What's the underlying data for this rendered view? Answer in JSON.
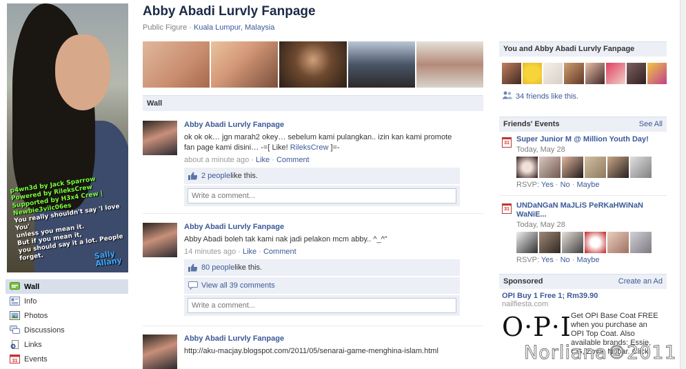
{
  "page": {
    "title": "Abby Abadi Lurvly Fanpage",
    "category": "Public Figure",
    "location": "Kuala Lumpur, Malaysia"
  },
  "profile_caption": {
    "line1": "p4wn3d by Jack Sparrow",
    "line2": "Powered by RileksCrew",
    "line3": "Supported by H3x4 Crew | Newbie3vilc06es",
    "line4": "You really shouldn't say 'I love You'",
    "line5": "unless you mean it.",
    "line6": "But if you mean it,",
    "line7": "you should say it a lot. People forget.",
    "line8": "Sally Allany"
  },
  "left_nav": {
    "items": [
      {
        "label": "Wall",
        "icon": "wall-icon",
        "active": true
      },
      {
        "label": "Info",
        "icon": "info-icon"
      },
      {
        "label": "Photos",
        "icon": "photos-icon"
      },
      {
        "label": "Discussions",
        "icon": "discussions-icon"
      },
      {
        "label": "Links",
        "icon": "links-icon"
      },
      {
        "label": "Events",
        "icon": "events-icon"
      }
    ]
  },
  "wall": {
    "header": "Wall",
    "comment_placeholder": "Write a comment...",
    "posts": [
      {
        "author": "Abby Abadi Lurvly Fanpage",
        "message_before": "ok ok ok… jgn marah2 okey… sebelum kami pulangkan.. izin kan kami promote fan page kami disini… -=[ Like! ",
        "message_link": "RileksCrew",
        "message_after": " ]=-",
        "time": "about a minute ago",
        "like": "Like",
        "comment": "Comment",
        "likes_count": "2 people",
        "likes_suffix": " like this."
      },
      {
        "author": "Abby Abadi Lurvly Fanpage",
        "message": "Abby Abadi boleh tak kami nak jadi pelakon mcm abby.. ^_^\"",
        "time": "14 minutes ago",
        "like": "Like",
        "comment": "Comment",
        "likes_count": "80 people",
        "likes_suffix": " like this.",
        "view_comments": "View all 39 comments"
      },
      {
        "author": "Abby Abadi Lurvly Fanpage",
        "link": "http://aku-macjay.blogspot.com/2011/05/senarai-game-menghina-islam.html"
      }
    ]
  },
  "right": {
    "fans_header": "You and Abby Abadi Lurvly Fanpage",
    "friends_like": "34 friends like this.",
    "events_header": "Friends' Events",
    "see_all": "See All",
    "events": [
      {
        "cal": "31",
        "title": "Super Junior M @ Million Youth Day!",
        "date": "Today, May 28",
        "rsvp_label": "RSVP:",
        "yes": "Yes",
        "no": "No",
        "maybe": "Maybe"
      },
      {
        "cal": "31",
        "title": "UNDaNGaN MaJLiS PeRKaHWiNaN WaNiE...",
        "date": "Today, May 28",
        "rsvp_label": "RSVP:",
        "yes": "Yes",
        "no": "No",
        "maybe": "Maybe"
      }
    ],
    "sponsored_header": "Sponsored",
    "create_ad": "Create an Ad",
    "ad": {
      "title": "OPI Buy 1 Free 1; Rm39.90",
      "domain": "nailfiesta.com",
      "logo": "O·P·I",
      "text": "Get OPI Base Coat FREE when you purchase an OPI Top Coat. Also available brands: Essie, CG, Zoya, Nubar. Click"
    }
  },
  "watermark": "Norliana©2011",
  "colors": {
    "brand": "#3b5998",
    "header_bg": "#eceff5",
    "title": "#1c2a47"
  }
}
